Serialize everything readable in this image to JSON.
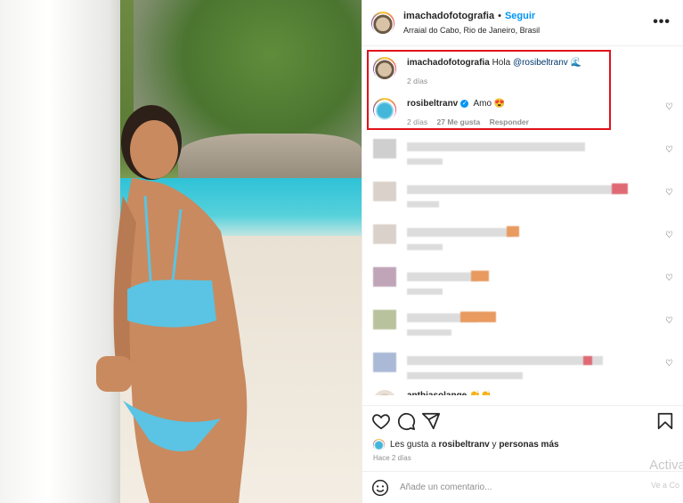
{
  "header": {
    "username": "imachadofotografia",
    "separator": "•",
    "follow": "Seguir",
    "location": "Arraial do Cabo, Rio de Janeiro, Brasil",
    "more": "•••"
  },
  "comments": [
    {
      "username": "imachadofotografia",
      "text": "Hola",
      "mention": "@rosibeltranv",
      "emoji": "🌊",
      "time": "2 días"
    },
    {
      "username": "rosibeltranv",
      "verified": true,
      "text": "Amo",
      "emoji": "😍",
      "time": "2 días",
      "likes": "27 Me gusta",
      "reply": "Responder"
    }
  ],
  "partial_username": "anthiasolange",
  "likes": {
    "prefix": "Les gusta a",
    "user": "rosibeltranv",
    "joiner": "y",
    "others": "personas más"
  },
  "time_ago": "Hace 2 días",
  "add_comment": {
    "placeholder": "Añade un comentario..."
  },
  "watermark": {
    "line1": "Activa",
    "line2": "Ve a Co"
  }
}
